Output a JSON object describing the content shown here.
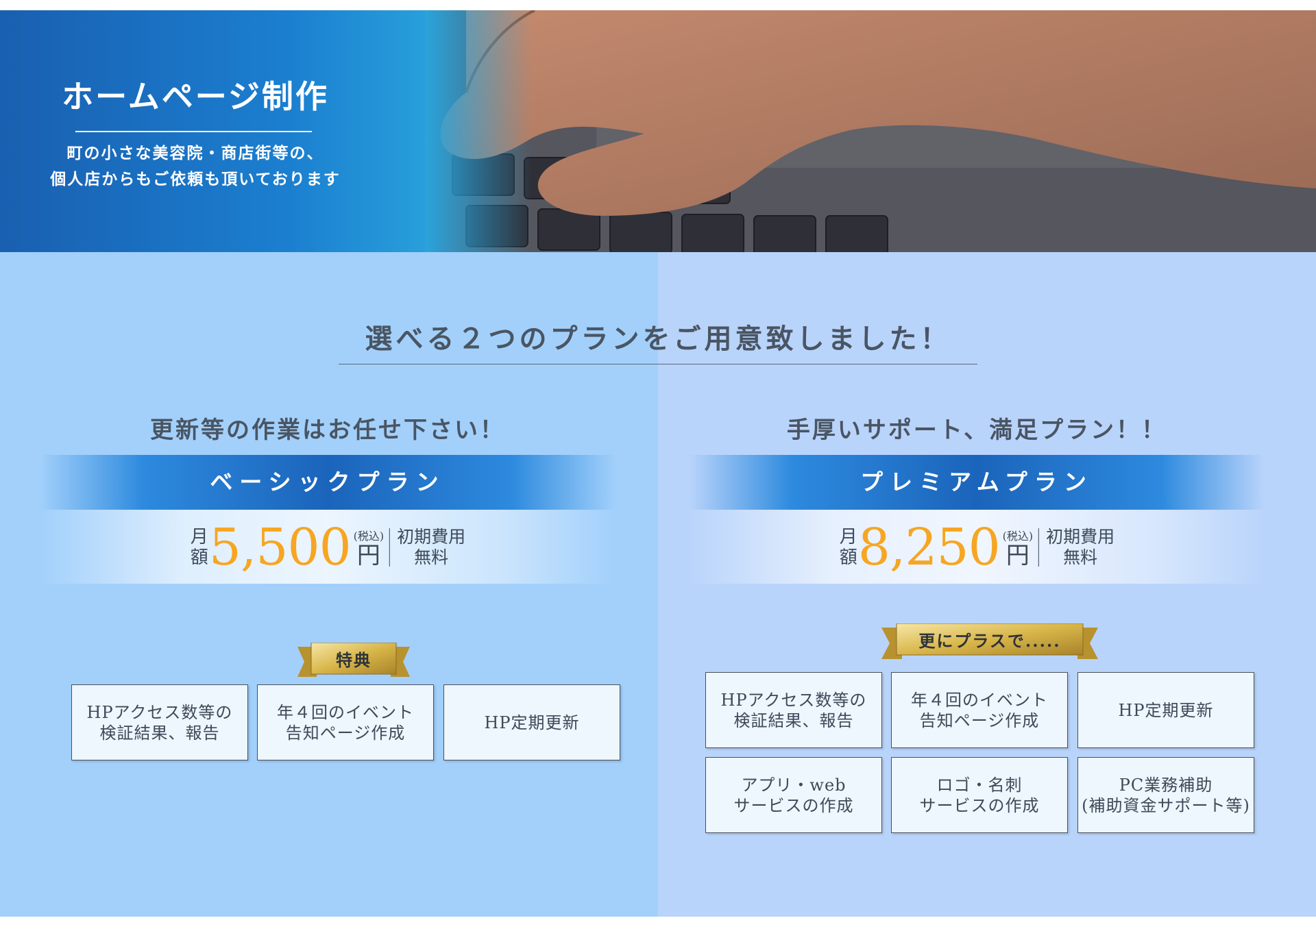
{
  "hero": {
    "title": "ホームページ制作",
    "subtitle_line1": "町の小さな美容院・商店街等の、",
    "subtitle_line2": "個人店からもご依頼も頂いております"
  },
  "main_heading": "選べる２つのプランをご用意致しました！",
  "plans": {
    "basic": {
      "catch": "更新等の作業はお任せ下さい！",
      "name": "ベーシックプラン",
      "unit_line1": "月",
      "unit_line2": "額",
      "price": "5,500",
      "tax_label": "(税込)",
      "yen": "円",
      "note_line1": "初期費用",
      "note_line2": "無料",
      "ribbon": "特典",
      "features": [
        "HPアクセス数等の\n検証結果、報告",
        "年４回のイベント\n告知ページ作成",
        "HP定期更新"
      ]
    },
    "premium": {
      "catch": "手厚いサポート、満足プラン！！",
      "name": "プレミアムプラン",
      "unit_line1": "月",
      "unit_line2": "額",
      "price": "8,250",
      "tax_label": "(税込)",
      "yen": "円",
      "note_line1": "初期費用",
      "note_line2": "無料",
      "ribbon": "更にプラスで.....",
      "features": [
        "HPアクセス数等の\n検証結果、報告",
        "年４回のイベント\n告知ページ作成",
        "HP定期更新",
        "アプリ・web\nサービスの作成",
        "ロゴ・名刺\nサービスの作成",
        "PC業務補助\n(補助資金サポート等)"
      ]
    }
  },
  "colors": {
    "price": "#f6a623",
    "panel_left": "#a2d0fb",
    "panel_right": "#b9d4fb",
    "band": "#1b64bb",
    "ribbon_gold": "#d9b64a"
  }
}
